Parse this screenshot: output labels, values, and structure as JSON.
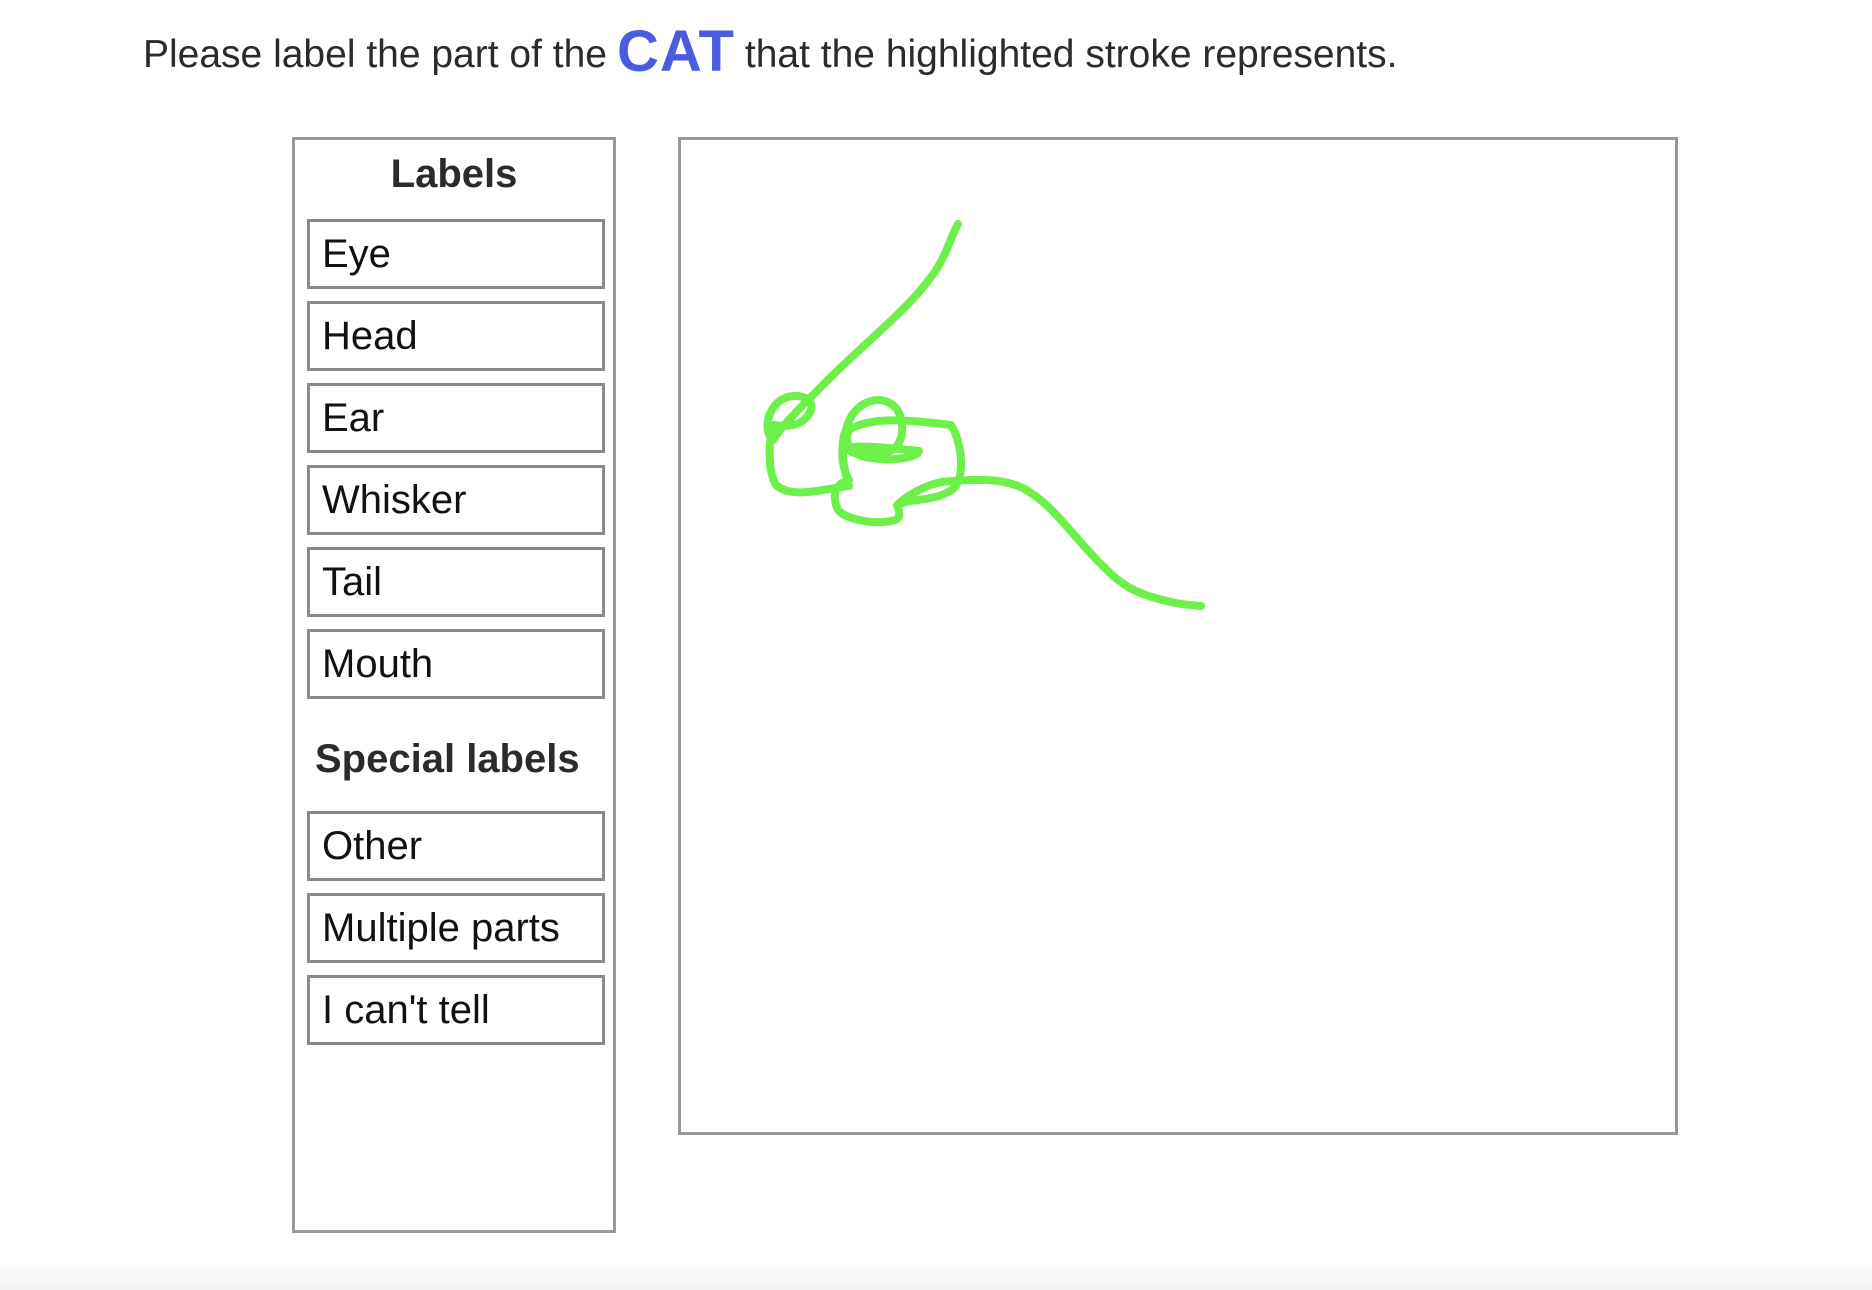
{
  "prompt": {
    "before": "Please label the part of the",
    "category": "CAT",
    "after": "that the highlighted stroke represents."
  },
  "labels_panel": {
    "heading": "Labels",
    "items": [
      "Eye",
      "Head",
      "Ear",
      "Whisker",
      "Tail",
      "Mouth"
    ],
    "special_heading": "Special labels",
    "special_items": [
      "Other",
      "Multiple parts",
      "I can't tell"
    ]
  },
  "canvas": {
    "stroke_color": "#6ef04a"
  },
  "colors": {
    "category": "#4a5be0",
    "border": "#999999"
  }
}
